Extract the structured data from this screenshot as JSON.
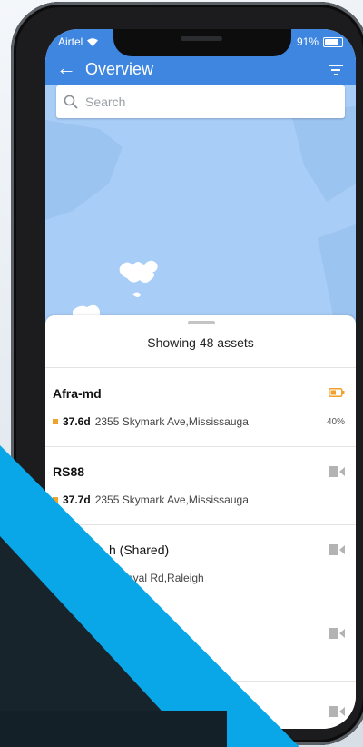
{
  "status": {
    "carrier": "Airtel",
    "battery": "91%"
  },
  "header": {
    "title": "Overview",
    "back_icon": "arrow-left-icon",
    "filter_icon": "filter-icon"
  },
  "search": {
    "placeholder": "Search"
  },
  "summary": {
    "text": "Showing 48 assets"
  },
  "colors": {
    "header": "#3f86e0",
    "map_water": "#a8cdf6",
    "accent_orange": "#f0a12c",
    "dark_band": "#18242c",
    "cyan_band": "#0aa7e8"
  },
  "assets": [
    {
      "name": "Afra-md",
      "days": "37.6d",
      "address": "2355 Skymark Ave,Mississauga",
      "battery_pct": "40%",
      "icon": "battery-low-icon"
    },
    {
      "name": "RS88",
      "days": "37.7d",
      "address": "2355 Skymark Ave,Mississauga",
      "icon": "video-camera-icon"
    },
    {
      "name": "h (Shared)",
      "address": "oyal Rd,Raleigh",
      "icon": "video-camera-icon"
    },
    {
      "name": "",
      "address": "",
      "icon": "video-camera-icon"
    },
    {
      "name": "",
      "address": "",
      "icon": "video-camera-icon"
    }
  ]
}
